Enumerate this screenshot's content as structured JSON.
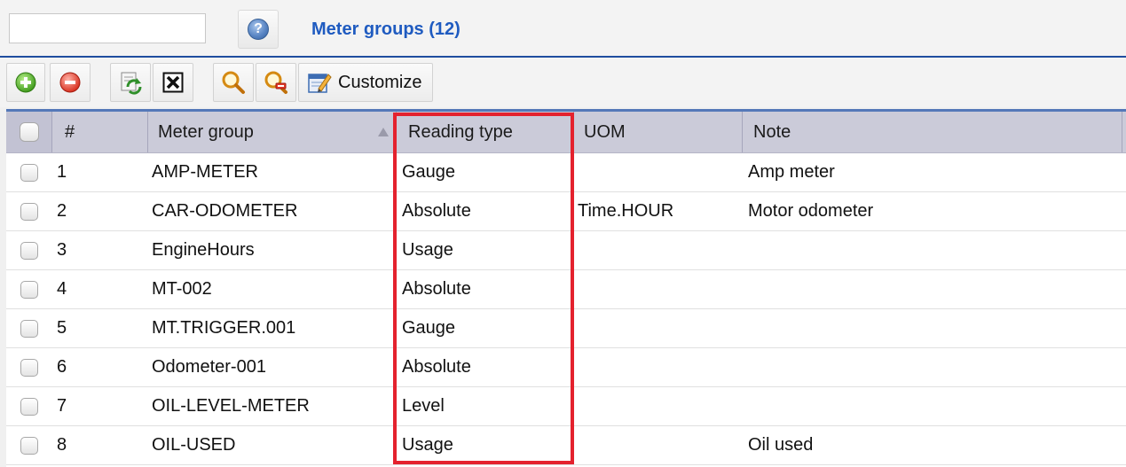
{
  "search": {
    "value": "",
    "placeholder": ""
  },
  "header": {
    "title": "Meter groups (12)"
  },
  "toolbar": {
    "customize_label": "Customize"
  },
  "grid": {
    "columns": [
      "#",
      "Meter group",
      "Reading type",
      "UOM",
      "Note"
    ],
    "sorted_column": "Meter group",
    "highlighted_column": "Reading type",
    "rows": [
      {
        "num": "1",
        "group": "AMP-METER",
        "reading": "Gauge",
        "uom": "",
        "note": "Amp meter"
      },
      {
        "num": "2",
        "group": "CAR-ODOMETER",
        "reading": "Absolute",
        "uom": "Time.HOUR",
        "note": "Motor odometer"
      },
      {
        "num": "3",
        "group": "EngineHours",
        "reading": "Usage",
        "uom": "",
        "note": ""
      },
      {
        "num": "4",
        "group": "MT-002",
        "reading": "Absolute",
        "uom": "",
        "note": ""
      },
      {
        "num": "5",
        "group": "MT.TRIGGER.001",
        "reading": "Gauge",
        "uom": "",
        "note": ""
      },
      {
        "num": "6",
        "group": "Odometer-001",
        "reading": "Absolute",
        "uom": "",
        "note": ""
      },
      {
        "num": "7",
        "group": "OIL-LEVEL-METER",
        "reading": "Level",
        "uom": "",
        "note": ""
      },
      {
        "num": "8",
        "group": "OIL-USED",
        "reading": "Usage",
        "uom": "",
        "note": "Oil used"
      }
    ]
  },
  "icons": {
    "add": "add-icon",
    "remove": "remove-icon",
    "refresh": "refresh-icon",
    "clear": "clear-icon",
    "search": "search-icon",
    "clear-search": "clear-search-icon",
    "customize": "customize-icon",
    "help": "help-icon"
  },
  "colors": {
    "title": "#1f5bc0",
    "highlight": "#e4222e",
    "header_bg": "#cbcbd9",
    "accent_line": "#1f4d9f"
  }
}
